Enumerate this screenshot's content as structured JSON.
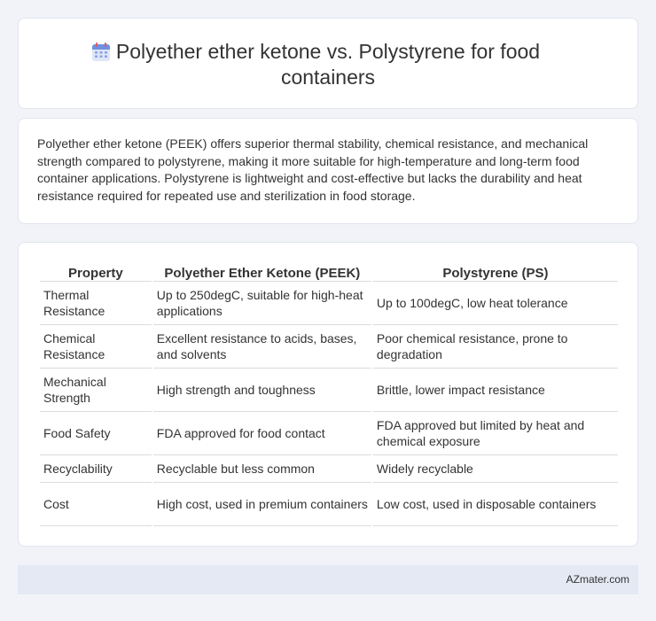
{
  "header": {
    "title": "Polyether ether ketone vs. Polystyrene for food containers",
    "icon": "calendar-icon"
  },
  "summary": {
    "text": "Polyether ether ketone (PEEK) offers superior thermal stability, chemical resistance, and mechanical strength compared to polystyrene, making it more suitable for high-temperature and long-term food container applications. Polystyrene is lightweight and cost-effective but lacks the durability and heat resistance required for repeated use and sterilization in food storage."
  },
  "table": {
    "headers": [
      "Property",
      "Polyether Ether Ketone (PEEK)",
      "Polystyrene (PS)"
    ],
    "rows": [
      [
        "Thermal Resistance",
        "Up to 250degC, suitable for high-heat applications",
        "Up to 100degC, low heat tolerance"
      ],
      [
        "Chemical Resistance",
        "Excellent resistance to acids, bases, and solvents",
        "Poor chemical resistance, prone to degradation"
      ],
      [
        "Mechanical Strength",
        "High strength and toughness",
        "Brittle, lower impact resistance"
      ],
      [
        "Food Safety",
        "FDA approved for food contact",
        "FDA approved but limited by heat and chemical exposure"
      ],
      [
        "Recyclability",
        "Recyclable but less common",
        "Widely recyclable"
      ],
      [
        "Cost",
        "High cost, used in premium containers",
        "Low cost, used in disposable containers"
      ]
    ]
  },
  "footer": {
    "brand": "AZmater.com"
  }
}
